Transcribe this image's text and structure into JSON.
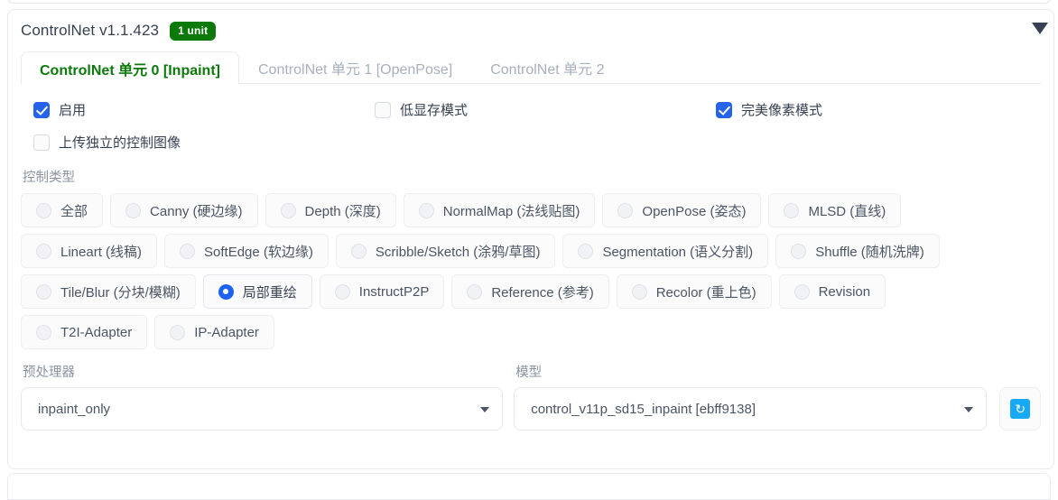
{
  "header": {
    "title": "ControlNet v1.1.423",
    "badge": "1 unit",
    "collapse_icon": "triangle-down-icon"
  },
  "tabs": [
    {
      "label": "ControlNet 单元 0 [Inpaint]",
      "active": true
    },
    {
      "label": "ControlNet 单元 1 [OpenPose]",
      "active": false
    },
    {
      "label": "ControlNet 单元 2",
      "active": false
    }
  ],
  "checkboxes": [
    {
      "label": "启用",
      "checked": true
    },
    {
      "label": "低显存模式",
      "checked": false
    },
    {
      "label": "完美像素模式",
      "checked": true
    },
    {
      "label": "上传独立的控制图像",
      "checked": false
    }
  ],
  "control_type": {
    "label": "控制类型",
    "selected": "局部重绘",
    "rows": [
      [
        {
          "label": "全部"
        },
        {
          "label": "Canny (硬边缘)"
        },
        {
          "label": "Depth (深度)"
        },
        {
          "label": "NormalMap (法线贴图)"
        },
        {
          "label": "OpenPose (姿态)"
        },
        {
          "label": "MLSD (直线)"
        }
      ],
      [
        {
          "label": "Lineart (线稿)"
        },
        {
          "label": "SoftEdge (软边缘)"
        },
        {
          "label": "Scribble/Sketch (涂鸦/草图)"
        },
        {
          "label": "Segmentation (语义分割)"
        },
        {
          "label": "Shuffle (随机洗牌)"
        }
      ],
      [
        {
          "label": "Tile/Blur (分块/模糊)"
        },
        {
          "label": "局部重绘"
        },
        {
          "label": "InstructP2P"
        },
        {
          "label": "Reference (参考)"
        },
        {
          "label": "Recolor (重上色)"
        },
        {
          "label": "Revision"
        }
      ],
      [
        {
          "label": "T2I-Adapter"
        },
        {
          "label": "IP-Adapter"
        }
      ]
    ]
  },
  "preprocessor": {
    "label": "预处理器",
    "value": "inpaint_only",
    "caret_icon": "chevron-down-icon"
  },
  "model": {
    "label": "模型",
    "value": "control_v11p_sd15_inpaint [ebff9138]",
    "caret_icon": "chevron-down-icon"
  },
  "refresh": {
    "icon": "refresh-icon",
    "glyph": "↻"
  },
  "colors": {
    "badge_green": "#0b7a0b",
    "accent_blue": "#2563eb",
    "radio_blue": "#1d62f0",
    "refresh_blue": "#18a9f5",
    "muted_text": "#8b93a1",
    "tab_inactive": "#a9b0bd"
  }
}
